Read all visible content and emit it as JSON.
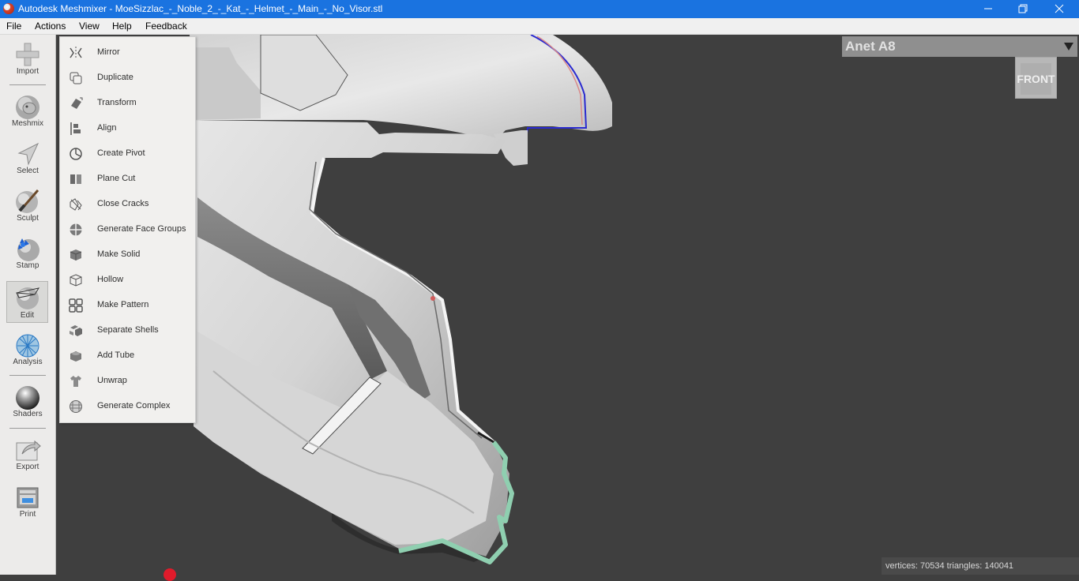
{
  "window": {
    "title": "Autodesk Meshmixer - MoeSizzlac_-_Noble_2_-_Kat_-_Helmet_-_Main_-_No_Visor.stl",
    "minimize_icon": "minimize-icon",
    "maximize_icon": "restore-icon",
    "close_icon": "close-icon"
  },
  "menubar": {
    "items": [
      "File",
      "Actions",
      "View",
      "Help",
      "Feedback"
    ]
  },
  "toolbar": {
    "tools": [
      {
        "label": "Import",
        "icon": "plus-icon"
      },
      {
        "label": "Meshmix",
        "icon": "meshmix-bunny-icon"
      },
      {
        "label": "Select",
        "icon": "arrow-cursor-icon"
      },
      {
        "label": "Sculpt",
        "icon": "brush-sphere-icon"
      },
      {
        "label": "Stamp",
        "icon": "stamp-sphere-icon"
      },
      {
        "label": "Edit",
        "icon": "edit-sphere-icon",
        "active": true
      },
      {
        "label": "Analysis",
        "icon": "mesh-sphere-icon"
      },
      {
        "label": "Shaders",
        "icon": "chrome-sphere-icon"
      },
      {
        "label": "Export",
        "icon": "export-icon"
      },
      {
        "label": "Print",
        "icon": "printer-icon"
      }
    ]
  },
  "edit_menu": {
    "items": [
      {
        "label": "Mirror",
        "icon": "mirror-icon"
      },
      {
        "label": "Duplicate",
        "icon": "duplicate-icon"
      },
      {
        "label": "Transform",
        "icon": "transform-icon"
      },
      {
        "label": "Align",
        "icon": "align-icon"
      },
      {
        "label": "Create Pivot",
        "icon": "pivot-icon"
      },
      {
        "label": "Plane Cut",
        "icon": "plane-cut-icon"
      },
      {
        "label": "Close Cracks",
        "icon": "close-cracks-icon"
      },
      {
        "label": "Generate Face Groups",
        "icon": "face-groups-icon"
      },
      {
        "label": "Make Solid",
        "icon": "solid-cube-icon"
      },
      {
        "label": "Hollow",
        "icon": "hollow-cube-icon"
      },
      {
        "label": "Make Pattern",
        "icon": "pattern-grid-icon"
      },
      {
        "label": "Separate Shells",
        "icon": "separate-shells-icon"
      },
      {
        "label": "Add Tube",
        "icon": "tube-icon"
      },
      {
        "label": "Unwrap",
        "icon": "unwrap-shirt-icon"
      },
      {
        "label": "Generate Complex",
        "icon": "complex-sphere-icon"
      }
    ]
  },
  "printer": {
    "name": "Anet A8",
    "dropdown_icon": "triangle-down-icon"
  },
  "viewcube": {
    "face": "FRONT"
  },
  "stats": {
    "text": "vertices: 70534 triangles: 140041"
  },
  "colors": {
    "titlebar": "#1a73e0",
    "viewport": "#3f3f3f",
    "selection_boundary": "#8fcfb0",
    "edge_highlight": "#2020c8"
  }
}
